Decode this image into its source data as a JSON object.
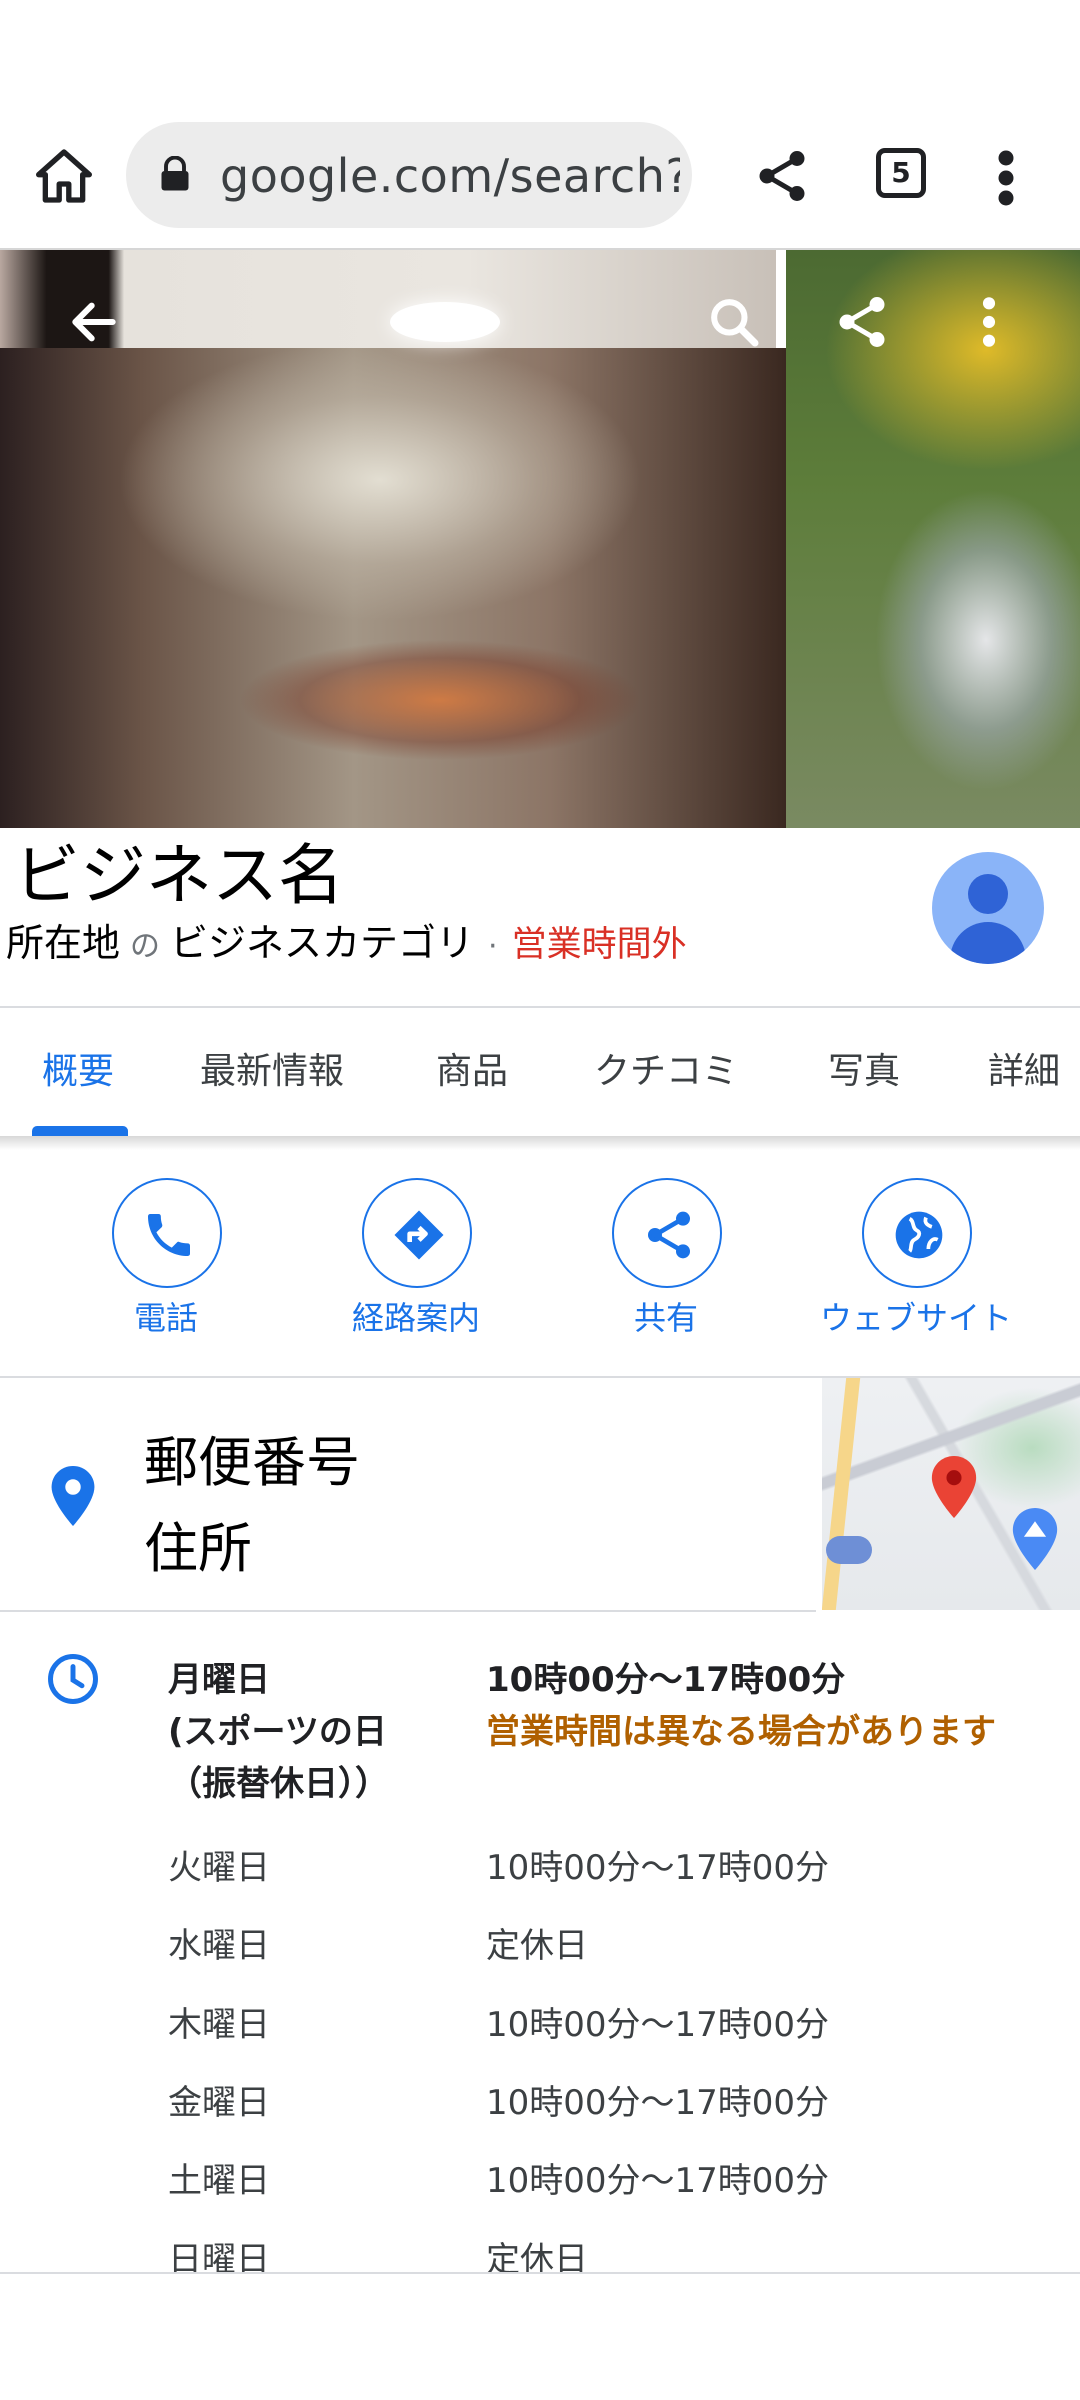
{
  "browser": {
    "url": "google.com/search?",
    "tab_count": "5"
  },
  "business": {
    "name": "ビジネス名",
    "location": "所在地",
    "connector": "の",
    "category": "ビジネスカテゴリ",
    "separator": "·",
    "status": "営業時間外"
  },
  "tabs": [
    {
      "label": "概要",
      "active": true
    },
    {
      "label": "最新情報"
    },
    {
      "label": "商品"
    },
    {
      "label": "クチコミ"
    },
    {
      "label": "写真"
    },
    {
      "label": "詳細"
    }
  ],
  "actions": [
    {
      "label": "電話",
      "icon": "phone-icon"
    },
    {
      "label": "経路案内",
      "icon": "directions-icon"
    },
    {
      "label": "共有",
      "icon": "share-icon"
    },
    {
      "label": "ウェブサイト",
      "icon": "globe-icon"
    }
  ],
  "address": {
    "line1": "郵便番号",
    "line2": "住所"
  },
  "hours": {
    "today": {
      "day_lines": [
        "月曜日",
        "(スポーツの日",
        "（振替休日））"
      ],
      "time": "10時00分～17時00分",
      "note": "営業時間は異なる場合があります"
    },
    "rows": [
      {
        "day": "火曜日",
        "time": "10時00分～17時00分"
      },
      {
        "day": "水曜日",
        "time": "定休日"
      },
      {
        "day": "木曜日",
        "time": "10時00分～17時00分"
      },
      {
        "day": "金曜日",
        "time": "10時00分～17時00分"
      },
      {
        "day": "土曜日",
        "time": "10時00分～17時00分"
      },
      {
        "day": "日曜日",
        "time": "定休日"
      }
    ]
  },
  "colors": {
    "accent": "#1a73e8",
    "closed": "#d93025",
    "warning": "#b06000"
  }
}
